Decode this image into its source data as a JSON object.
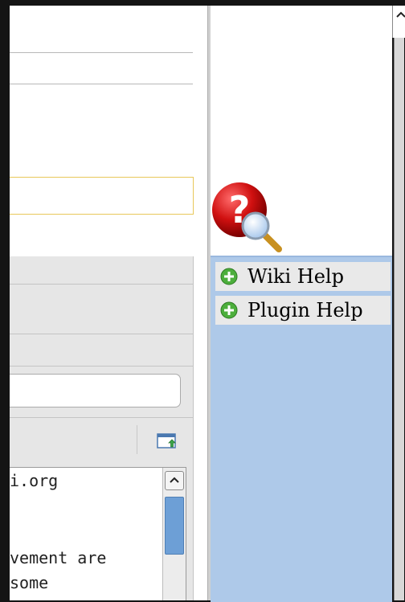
{
  "editor": {
    "textarea_lines": [
      "i.org",
      "",
      "",
      "vement are",
      "some"
    ]
  },
  "help_panel": {
    "items": [
      {
        "label": "Wiki Help",
        "icon": "plus-circle-icon"
      },
      {
        "label": "Plugin Help",
        "icon": "plus-circle-icon"
      }
    ],
    "icon": "help-magnifier-icon"
  },
  "colors": {
    "help_list_bg": "#aec9e9",
    "input_highlight": "#e8c85a",
    "scroll_thumb": "#6d9fd6"
  }
}
